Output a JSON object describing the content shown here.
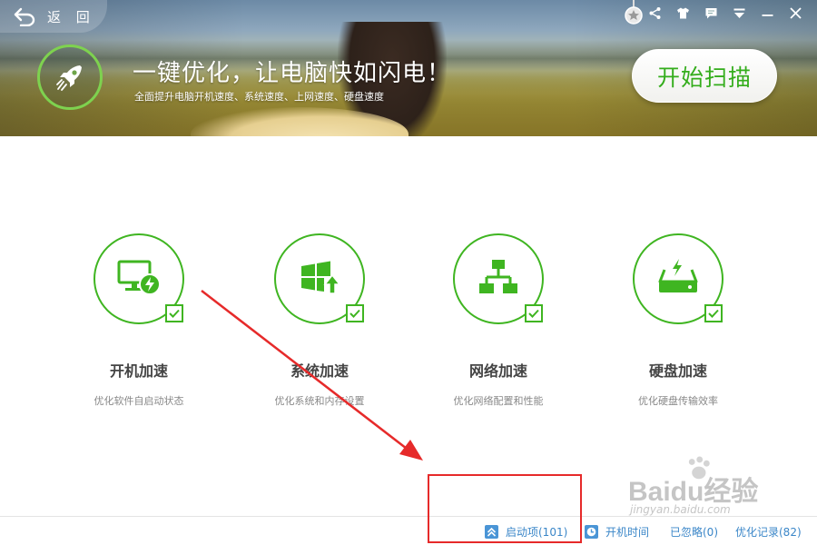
{
  "header": {
    "back_label": "返 回",
    "title": "一键优化，让电脑快如闪电！",
    "subtitle": "全面提升电脑开机速度、系统速度、上网速度、硬盘速度",
    "scan_button": "开始扫描",
    "window_controls": [
      "share-icon",
      "skin-icon",
      "message-icon",
      "menu-icon",
      "minimize-icon",
      "close-icon"
    ]
  },
  "features": [
    {
      "icon": "monitor-bolt-icon",
      "title": "开机加速",
      "desc": "优化软件自启动状态",
      "checked": true
    },
    {
      "icon": "windows-upgrade-icon",
      "title": "系统加速",
      "desc": "优化系统和内存设置",
      "checked": true
    },
    {
      "icon": "network-icon",
      "title": "网络加速",
      "desc": "优化网络配置和性能",
      "checked": true
    },
    {
      "icon": "disk-icon",
      "title": "硬盘加速",
      "desc": "优化硬盘传输效率",
      "checked": true
    }
  ],
  "footer": {
    "startup_items": "启动项(101)",
    "boot_time": "开机时间",
    "ignored": "已忽略(0)",
    "history": "优化记录(82)"
  },
  "watermark": {
    "text": "Baidu经验",
    "url": "jingyan.baidu.com"
  },
  "colors": {
    "accent_green": "#3fb521",
    "link_blue": "#3a86c8",
    "annotation_red": "#e62a2a"
  }
}
